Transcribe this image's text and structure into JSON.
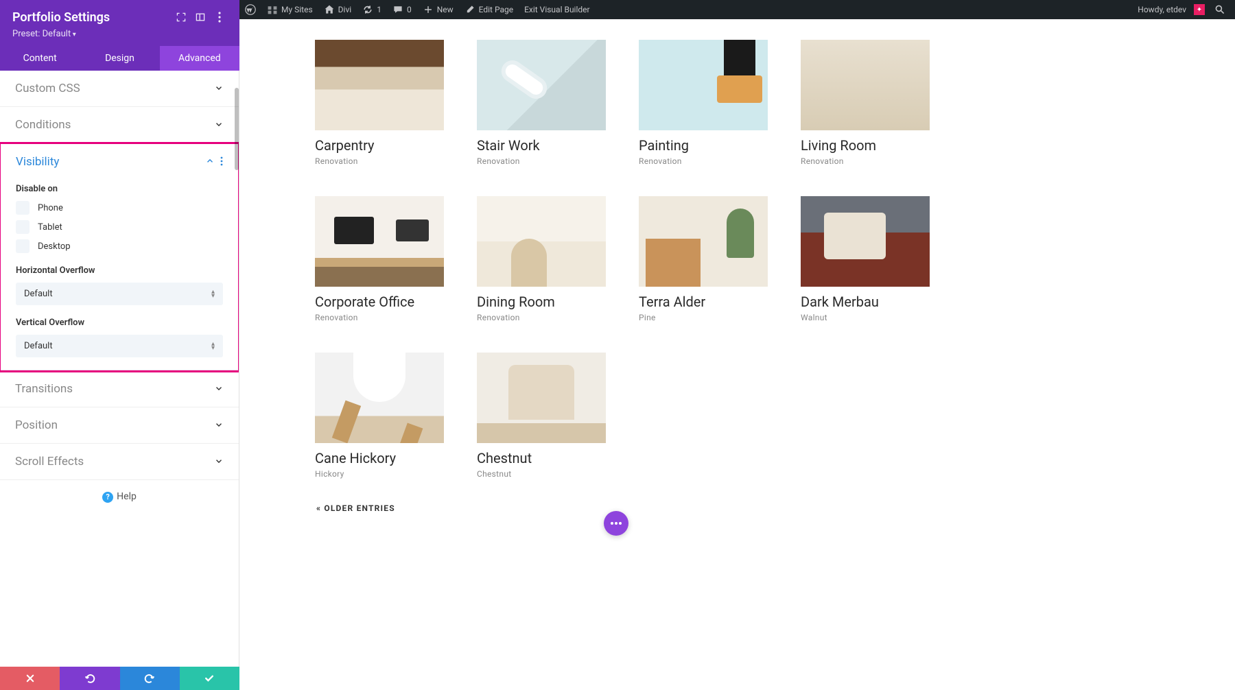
{
  "wp": {
    "mysites": "My Sites",
    "divi": "Divi",
    "updates": "1",
    "comments": "0",
    "new": "New",
    "edit": "Edit Page",
    "exit": "Exit Visual Builder",
    "howdy": "Howdy, etdev"
  },
  "sb": {
    "title": "Portfolio Settings",
    "preset": "Preset: Default",
    "tabs": {
      "content": "Content",
      "design": "Design",
      "advanced": "Advanced"
    },
    "sections": {
      "css": "Custom CSS",
      "cond": "Conditions",
      "vis": "Visibility",
      "trans": "Transitions",
      "pos": "Position",
      "scroll": "Scroll Effects"
    },
    "vis": {
      "disable": "Disable on",
      "phone": "Phone",
      "tablet": "Tablet",
      "desktop": "Desktop",
      "hov": "Horizontal Overflow",
      "vov": "Vertical Overflow",
      "default": "Default"
    },
    "help": "Help"
  },
  "portfolio": [
    {
      "title": "Carpentry",
      "cat": "Renovation",
      "t": "t1"
    },
    {
      "title": "Stair Work",
      "cat": "Renovation",
      "t": "t2"
    },
    {
      "title": "Painting",
      "cat": "Renovation",
      "t": "t3"
    },
    {
      "title": "Living Room",
      "cat": "Renovation",
      "t": "t4"
    },
    {
      "title": "Corporate Office",
      "cat": "Renovation",
      "t": "t5"
    },
    {
      "title": "Dining Room",
      "cat": "Renovation",
      "t": "t6"
    },
    {
      "title": "Terra Alder",
      "cat": "Pine",
      "t": "t7"
    },
    {
      "title": "Dark Merbau",
      "cat": "Walnut",
      "t": "t8"
    },
    {
      "title": "Cane Hickory",
      "cat": "Hickory",
      "t": "t9"
    },
    {
      "title": "Chestnut",
      "cat": "Chestnut",
      "t": "t10"
    }
  ],
  "older": "« OLDER ENTRIES"
}
